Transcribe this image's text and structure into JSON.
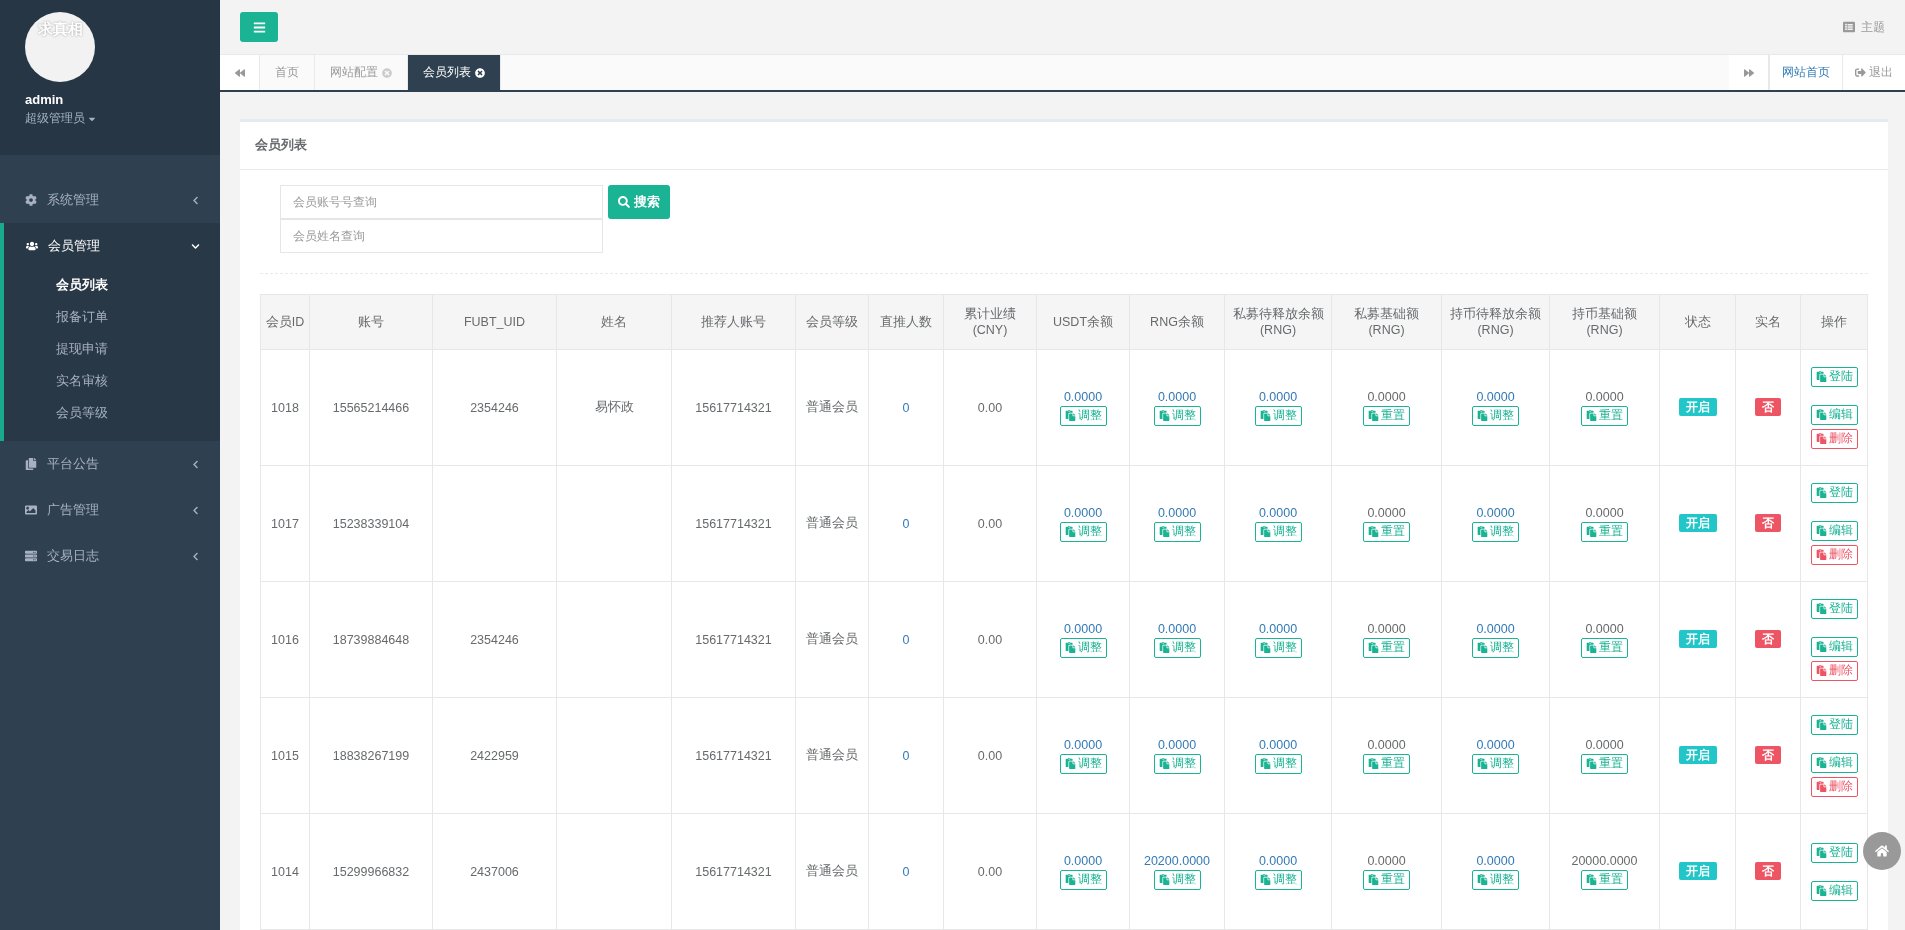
{
  "sidebar": {
    "avatar_text": "求真相",
    "user": "admin",
    "role": "超级管理员",
    "menu": [
      {
        "label": "系统管理",
        "expanded": false
      },
      {
        "label": "会员管理",
        "expanded": true,
        "children": [
          {
            "label": "会员列表",
            "selected": true
          },
          {
            "label": "报备订单",
            "selected": false
          },
          {
            "label": "提现申请",
            "selected": false
          },
          {
            "label": "实名审核",
            "selected": false
          },
          {
            "label": "会员等级",
            "selected": false
          }
        ]
      },
      {
        "label": "平台公告",
        "expanded": false
      },
      {
        "label": "广告管理",
        "expanded": false
      },
      {
        "label": "交易日志",
        "expanded": false
      }
    ]
  },
  "header": {
    "theme_label": "主题"
  },
  "tabs": [
    {
      "label": "首页",
      "closable": false,
      "selected": false
    },
    {
      "label": "网站配置",
      "closable": true,
      "selected": false
    },
    {
      "label": "会员列表",
      "closable": true,
      "selected": true
    }
  ],
  "tab_links": {
    "home": "网站首页",
    "logout": "退出"
  },
  "panel": {
    "title": "会员列表",
    "search_fields": [
      {
        "placeholder": "会员账号号查询"
      },
      {
        "placeholder": "会员姓名查询"
      }
    ],
    "search_button": "搜索"
  },
  "table": {
    "columns": [
      "会员ID",
      "账号",
      "FUBT_UID",
      "姓名",
      "推荐人账号",
      "会员等级",
      "直推人数",
      "累计业绩(CNY)",
      "USDT余额",
      "RNG余额",
      "私募待释放余额(RNG)",
      "私募基础额(RNG)",
      "持币待释放余额(RNG)",
      "持币基础额(RNG)",
      "状态",
      "实名",
      "操作"
    ],
    "rows": [
      {
        "id": "1018",
        "account": "15565214466",
        "uid": "2354246",
        "name": "易怀政",
        "referrer": "15617714321",
        "level": "普通会员",
        "direct": "0",
        "performance": "0.00",
        "balances": [
          {
            "kind": "adjust",
            "value": "0.0000",
            "button": "调整"
          },
          {
            "kind": "adjust",
            "value": "0.0000",
            "button": "调整"
          },
          {
            "kind": "adjust",
            "value": "0.0000",
            "button": "调整"
          },
          {
            "kind": "reset",
            "value": "0.0000",
            "button": "重置"
          },
          {
            "kind": "adjust",
            "value": "0.0000",
            "button": "调整"
          },
          {
            "kind": "reset",
            "value": "0.0000",
            "button": "重置"
          }
        ],
        "status": {
          "label": "开启",
          "on": true
        },
        "realname": {
          "label": "否",
          "verified": false
        },
        "actions": [
          {
            "kind": "login",
            "label": "登陆"
          },
          {
            "kind": "edit",
            "label": "编辑"
          },
          {
            "kind": "delete",
            "label": "删除"
          }
        ]
      },
      {
        "id": "1017",
        "account": "15238339104",
        "referrer": "15617714321",
        "level": "普通会员",
        "direct": "0",
        "performance": "0.00",
        "balances": [
          {
            "kind": "adjust",
            "value": "0.0000",
            "button": "调整"
          },
          {
            "kind": "adjust",
            "value": "0.0000",
            "button": "调整"
          },
          {
            "kind": "adjust",
            "value": "0.0000",
            "button": "调整"
          },
          {
            "kind": "reset",
            "value": "0.0000",
            "button": "重置"
          },
          {
            "kind": "adjust",
            "value": "0.0000",
            "button": "调整"
          },
          {
            "kind": "reset",
            "value": "0.0000",
            "button": "重置"
          }
        ],
        "status": {
          "label": "开启",
          "on": true
        },
        "realname": {
          "label": "否",
          "verified": false
        },
        "actions": [
          {
            "kind": "login",
            "label": "登陆"
          },
          {
            "kind": "edit",
            "label": "编辑"
          },
          {
            "kind": "delete",
            "label": "删除"
          }
        ]
      },
      {
        "id": "1016",
        "account": "18739884648",
        "uid": "2354246",
        "referrer": "15617714321",
        "level": "普通会员",
        "direct": "0",
        "performance": "0.00",
        "balances": [
          {
            "kind": "adjust",
            "value": "0.0000",
            "button": "调整"
          },
          {
            "kind": "adjust",
            "value": "0.0000",
            "button": "调整"
          },
          {
            "kind": "adjust",
            "value": "0.0000",
            "button": "调整"
          },
          {
            "kind": "reset",
            "value": "0.0000",
            "button": "重置"
          },
          {
            "kind": "adjust",
            "value": "0.0000",
            "button": "调整"
          },
          {
            "kind": "reset",
            "value": "0.0000",
            "button": "重置"
          }
        ],
        "status": {
          "label": "开启",
          "on": true
        },
        "realname": {
          "label": "否",
          "verified": false
        },
        "actions": [
          {
            "kind": "login",
            "label": "登陆"
          },
          {
            "kind": "edit",
            "label": "编辑"
          },
          {
            "kind": "delete",
            "label": "删除"
          }
        ]
      },
      {
        "id": "1015",
        "account": "18838267199",
        "uid": "2422959",
        "referrer": "15617714321",
        "level": "普通会员",
        "direct": "0",
        "performance": "0.00",
        "balances": [
          {
            "kind": "adjust",
            "value": "0.0000",
            "button": "调整"
          },
          {
            "kind": "adjust",
            "value": "0.0000",
            "button": "调整"
          },
          {
            "kind": "adjust",
            "value": "0.0000",
            "button": "调整"
          },
          {
            "kind": "reset",
            "value": "0.0000",
            "button": "重置"
          },
          {
            "kind": "adjust",
            "value": "0.0000",
            "button": "调整"
          },
          {
            "kind": "reset",
            "value": "0.0000",
            "button": "重置"
          }
        ],
        "status": {
          "label": "开启",
          "on": true
        },
        "realname": {
          "label": "否",
          "verified": false
        },
        "actions": [
          {
            "kind": "login",
            "label": "登陆"
          },
          {
            "kind": "edit",
            "label": "编辑"
          },
          {
            "kind": "delete",
            "label": "删除"
          }
        ]
      },
      {
        "id": "1014",
        "account": "15299966832",
        "uid": "2437006",
        "referrer": "15617714321",
        "level": "普通会员",
        "direct": "0",
        "performance": "0.00",
        "balances": [
          {
            "kind": "adjust",
            "value": "0.0000",
            "button": "调整"
          },
          {
            "kind": "adjust",
            "value": "20200.0000",
            "button": "调整"
          },
          {
            "kind": "adjust",
            "value": "0.0000",
            "button": "调整"
          },
          {
            "kind": "reset",
            "value": "0.0000",
            "button": "重置"
          },
          {
            "kind": "adjust",
            "value": "0.0000",
            "button": "调整"
          },
          {
            "kind": "reset",
            "value": "20000.0000",
            "button": "重置"
          }
        ],
        "status": {
          "label": "开启",
          "on": true
        },
        "realname": {
          "label": "否",
          "verified": false
        },
        "actions": [
          {
            "kind": "login",
            "label": "登陆"
          },
          {
            "kind": "edit",
            "label": "编辑"
          }
        ]
      }
    ]
  }
}
